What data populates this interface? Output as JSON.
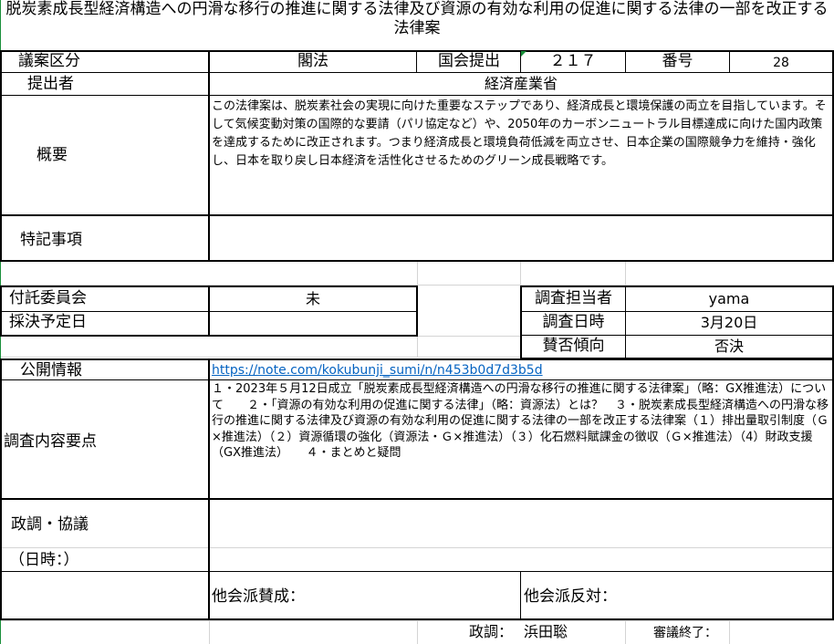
{
  "title": "脱炭素成長型経済構造への円滑な移行の推進に関する法律及び資源の有効な利用の促進に関する法律の一部を改正する法律案",
  "bill_category_label": "議案区分",
  "bill_category_value": "閣法",
  "diet_session_label": "国会提出",
  "diet_session_value": "２１７",
  "number_label": "番号",
  "number_value": "28",
  "submitter_label": "提出者",
  "submitter_value": "経済産業省",
  "overview_label": "概要",
  "overview_text": "この法律案は、脱炭素社会の実現に向けた重要なステップであり、経済成長と環境保護の両立を目指しています。そして気候変動対策の国際的な要請（パリ協定など）や、2050年のカーボンニュートラル目標達成に向けた国内政策を達成するために改正されます。つまり経済成長と環境負荷低減を両立させ、日本企業の国際競争力を維持・強化し、日本を取り戻し日本経済を活性化させるためのグリーン成長戦略です。",
  "special_notes_label": "特記事項",
  "special_notes_value": "",
  "committee_label": "付託委員会",
  "committee_value": "未",
  "vote_date_label": "採決予定日",
  "vote_date_value": "",
  "investigator_label": "調査担当者",
  "investigator_value": "yama",
  "investigation_date_label": "調査日時",
  "investigation_date_value": "3月20日",
  "stance_label": "賛否傾向",
  "stance_value": "否決",
  "public_info_label": "公開情報",
  "public_info_link": "https://note.com/kokubunji_sumi/n/n453b0d7d3b5d",
  "investigation_points_label": "調査内容要点",
  "investigation_points_text": "１・2023年５月12日成立「脱炭素成長型経済構造への円滑な移行の推進に関する法律案」（略：GX推進法）について　　２・「資源の有効な利用の促進に関する法律」（略：資源法）とは？　３・脱炭素成長型経済構造への円滑な移行の推進に関する法律及び資源の有効な利用の促進に関する法律の一部を改正する法律案（１）排出量取引制度（Ｇ×推進法）（２）資源循環の強化（資源法・Ｇ×推進法）（３）化石燃料賦課金の徴収（Ｇ×推進法）（4）財政支援（GX推進法）　　４・まとめと疑問",
  "policy_label": "政調・協議",
  "datetime_label": "（日時：）",
  "other_support_label": "他会派賛成：",
  "other_oppose_label": "他会派反対：",
  "policy_research_label": "政調：",
  "policy_research_value": "浜田聡",
  "deliberation_end_label": "審議終了：",
  "deliberation_end_value": ""
}
